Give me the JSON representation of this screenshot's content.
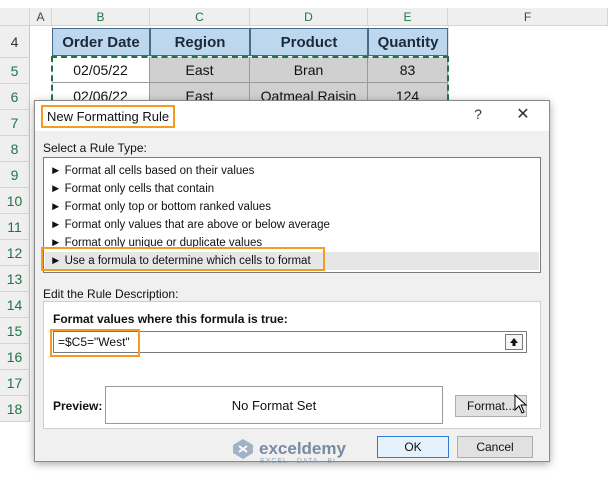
{
  "spreadsheet": {
    "column_headers": [
      "A",
      "B",
      "C",
      "D",
      "E",
      "F"
    ],
    "row_numbers": [
      "4",
      "5",
      "6",
      "7",
      "8",
      "9",
      "10",
      "11",
      "12",
      "13",
      "14",
      "15",
      "16",
      "17",
      "18"
    ],
    "table_headers": [
      "Order Date",
      "Region",
      "Product",
      "Quantity"
    ],
    "rows": [
      [
        "02/05/22",
        "East",
        "Bran",
        "83"
      ],
      [
        "02/06/22",
        "East",
        "Oatmeal Raisin",
        "124"
      ]
    ]
  },
  "dialog": {
    "title": "New Formatting Rule",
    "help_label": "?",
    "close_label": "✕",
    "select_rule_type_label": "Select a Rule Type:",
    "rule_types": [
      "► Format all cells based on their values",
      "► Format only cells that contain",
      "► Format only top or bottom ranked values",
      "► Format only values that are above or below average",
      "► Format only unique or duplicate values",
      "► Use a formula to determine which cells to format"
    ],
    "selected_rule_index": 5,
    "edit_description_label": "Edit the Rule Description:",
    "formula_label": "Format values where this formula is true:",
    "formula_value": "=$C5=\"West\"",
    "preview_label": "Preview:",
    "preview_text": "No Format Set",
    "format_button": "Format...",
    "ok_button": "OK",
    "cancel_button": "Cancel"
  },
  "watermark": {
    "brand": "exceldemy",
    "tagline": "EXCEL · DATA · BI"
  },
  "colors": {
    "highlight_outline": "#f39c1f",
    "table_header_bg": "#bdd7ee",
    "selected_cell_border": "#217346"
  }
}
